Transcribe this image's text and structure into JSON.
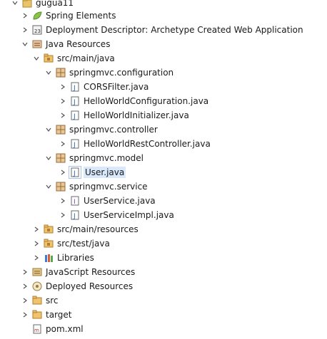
{
  "tree": {
    "items": [
      {
        "label": "gugua11",
        "icon": "project-icon",
        "chevron": "expanded"
      },
      {
        "label": "Spring Elements",
        "icon": "spring-leaf-icon",
        "chevron": "collapsed"
      },
      {
        "label": "Deployment Descriptor: Archetype Created Web Application",
        "icon": "deployment-descriptor-icon",
        "chevron": "collapsed"
      },
      {
        "label": "Java Resources",
        "icon": "java-resources-icon",
        "chevron": "expanded"
      },
      {
        "label": "src/main/java",
        "icon": "source-folder-icon",
        "chevron": "expanded"
      },
      {
        "label": "springmvc.configuration",
        "icon": "package-icon",
        "chevron": "expanded"
      },
      {
        "label": "CORSFilter.java",
        "icon": "java-file-icon",
        "chevron": "collapsed"
      },
      {
        "label": "HelloWorldConfiguration.java",
        "icon": "java-file-icon",
        "chevron": "collapsed"
      },
      {
        "label": "HelloWorldInitializer.java",
        "icon": "java-file-icon",
        "chevron": "collapsed"
      },
      {
        "label": "springmvc.controller",
        "icon": "package-icon",
        "chevron": "expanded"
      },
      {
        "label": "HelloWorldRestController.java",
        "icon": "java-file-icon",
        "chevron": "collapsed"
      },
      {
        "label": "springmvc.model",
        "icon": "package-icon",
        "chevron": "expanded"
      },
      {
        "label": "User.java",
        "icon": "java-file-icon",
        "chevron": "collapsed"
      },
      {
        "label": "springmvc.service",
        "icon": "package-icon",
        "chevron": "expanded"
      },
      {
        "label": "UserService.java",
        "icon": "java-interface-icon",
        "chevron": "collapsed"
      },
      {
        "label": "UserServiceImpl.java",
        "icon": "java-file-icon",
        "chevron": "collapsed"
      },
      {
        "label": "src/main/resources",
        "icon": "source-folder-icon",
        "chevron": "collapsed"
      },
      {
        "label": "src/test/java",
        "icon": "source-folder-icon",
        "chevron": "collapsed"
      },
      {
        "label": "Libraries",
        "icon": "libraries-icon",
        "chevron": "collapsed"
      },
      {
        "label": "JavaScript Resources",
        "icon": "javascript-resources-icon",
        "chevron": "collapsed"
      },
      {
        "label": "Deployed Resources",
        "icon": "deployed-resources-icon",
        "chevron": "collapsed"
      },
      {
        "label": "src",
        "icon": "folder-icon",
        "chevron": "collapsed"
      },
      {
        "label": "target",
        "icon": "folder-icon",
        "chevron": "collapsed"
      },
      {
        "label": "pom.xml",
        "icon": "xml-file-icon",
        "chevron": "none"
      }
    ],
    "selected_label": "User.java"
  }
}
